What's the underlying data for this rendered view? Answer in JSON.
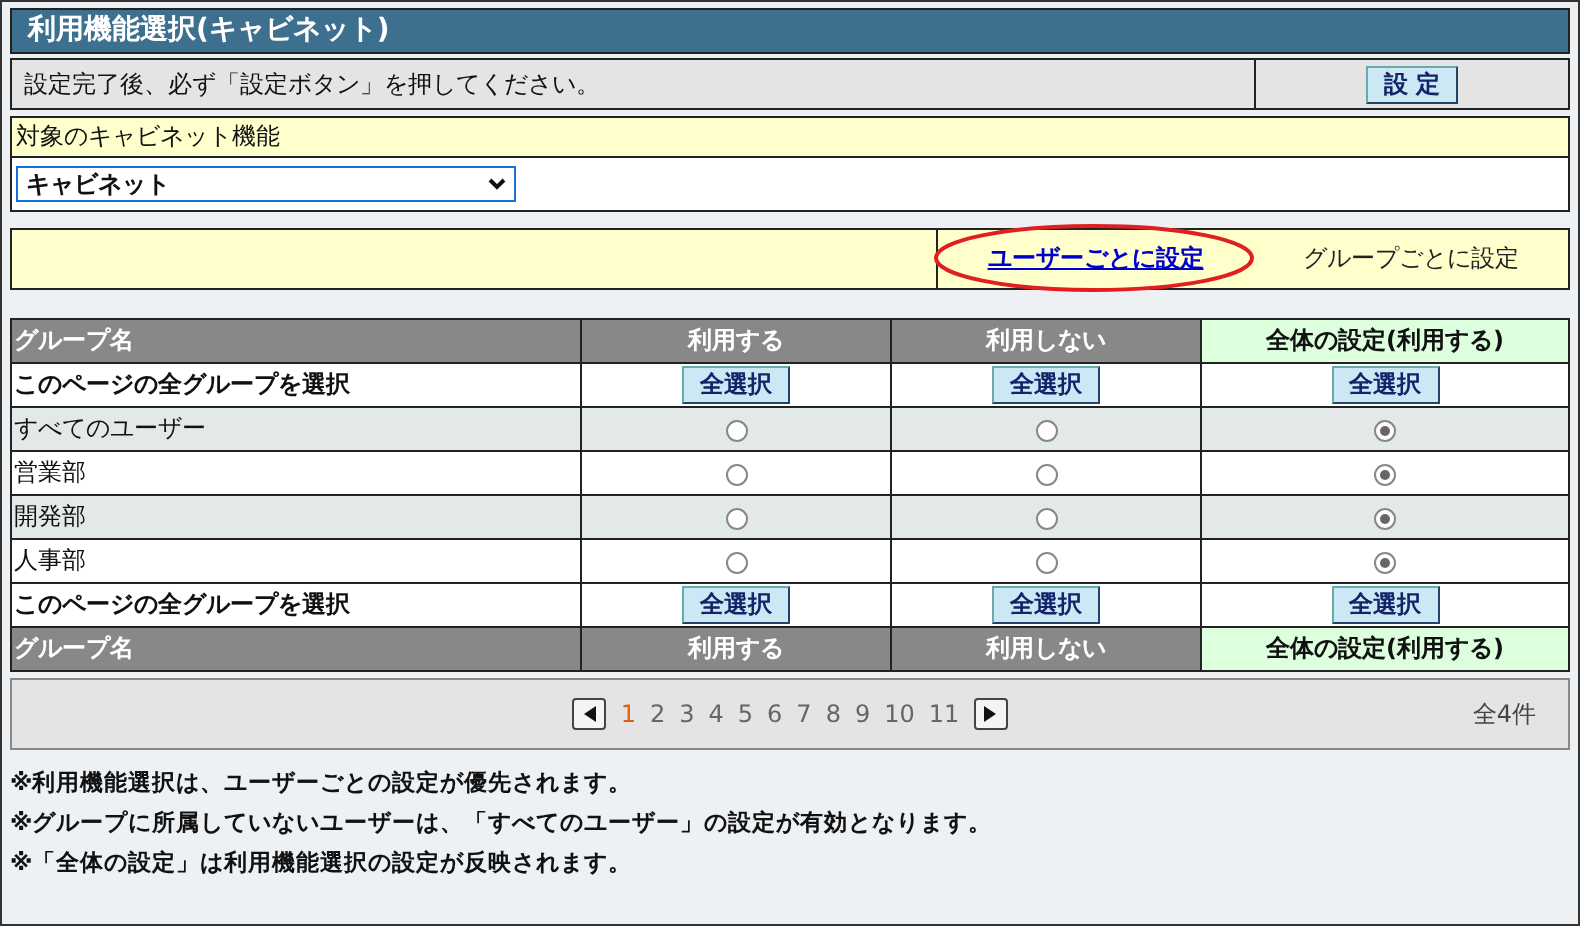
{
  "window": {
    "title": "利用機能選択(キャビネット)"
  },
  "notice": {
    "text": "設定完了後、必ず「設定ボタン」を押してください。",
    "button": "設 定"
  },
  "target": {
    "label": "対象のキャビネット機能",
    "select_value": "キャビネット"
  },
  "tabs": [
    {
      "label": "ユーザーごとに設定",
      "selected": false
    },
    {
      "label": "グループごとに設定",
      "selected": true
    }
  ],
  "table": {
    "columns": [
      "グループ名",
      "利用する",
      "利用しない",
      "全体の設定(利用する)"
    ],
    "select_all_label": "このページの全グループを選択",
    "select_all_buttons": [
      "全選択",
      "全選択",
      "全選択"
    ],
    "rows": [
      {
        "name": "すべてのユーザー",
        "options": [
          {
            "selected": false
          },
          {
            "selected": false
          },
          {
            "selected": true
          }
        ]
      },
      {
        "name": "営業部",
        "options": [
          {
            "selected": false
          },
          {
            "selected": false
          },
          {
            "selected": true
          }
        ]
      },
      {
        "name": "開発部",
        "options": [
          {
            "selected": false
          },
          {
            "selected": false
          },
          {
            "selected": true
          }
        ]
      },
      {
        "name": "人事部",
        "options": [
          {
            "selected": false
          },
          {
            "selected": false
          },
          {
            "selected": true
          }
        ]
      }
    ],
    "footer_select_all_label": "このページの全グループを選択",
    "footer_select_all_buttons": [
      "全選択",
      "全選択",
      "全選択"
    ],
    "footer_columns": [
      "グループ名",
      "利用する",
      "利用しない",
      "全体の設定(利用する)"
    ]
  },
  "pagination": {
    "pages": [
      {
        "label": "1",
        "selected": true
      },
      {
        "label": "2",
        "selected": false
      },
      {
        "label": "3",
        "selected": false
      },
      {
        "label": "4",
        "selected": false
      },
      {
        "label": "5",
        "selected": false
      },
      {
        "label": "6",
        "selected": false
      },
      {
        "label": "7",
        "selected": false
      },
      {
        "label": "8",
        "selected": false
      },
      {
        "label": "9",
        "selected": false
      },
      {
        "label": "10",
        "selected": false
      },
      {
        "label": "11",
        "selected": false
      }
    ],
    "total": "全4件"
  },
  "notes": [
    "※利用機能選択は、ユーザーごとの設定が優先されます。",
    "※グループに所属していないユーザーは、「すべてのユーザー」の設定が有効となります。",
    "※「全体の設定」は利用機能選択の設定が反映されます。"
  ]
}
